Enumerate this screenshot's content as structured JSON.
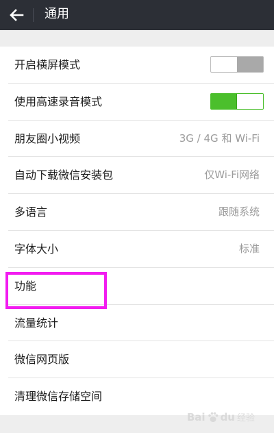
{
  "header": {
    "title": "通用",
    "back_icon": "arrow-left-icon"
  },
  "settings": {
    "landscape_mode": {
      "label": "开启横屏模式",
      "enabled": false
    },
    "hq_recording": {
      "label": "使用高速录音模式",
      "enabled": true
    },
    "moments_video": {
      "label": "朋友圈小视频",
      "value": "3G / 4G 和 Wi-Fi"
    },
    "auto_download": {
      "label": "自动下载微信安装包",
      "value": "仅Wi-Fi网络"
    },
    "language": {
      "label": "多语言",
      "value": "跟随系统"
    },
    "font_size": {
      "label": "字体大小",
      "value": "标准"
    },
    "features": {
      "label": "功能"
    },
    "traffic_stats": {
      "label": "流量统计"
    },
    "web_wechat": {
      "label": "微信网页版"
    },
    "clear_storage": {
      "label": "清理微信存储空间"
    }
  },
  "watermark": {
    "brand_left": "Bai",
    "brand_right": "du",
    "sub": "经验"
  },
  "colors": {
    "titlebar": "#2c2f36",
    "toggle_on": "#4bbf2c",
    "toggle_off": "#a9a9a9",
    "highlight": "#f21cf0"
  }
}
